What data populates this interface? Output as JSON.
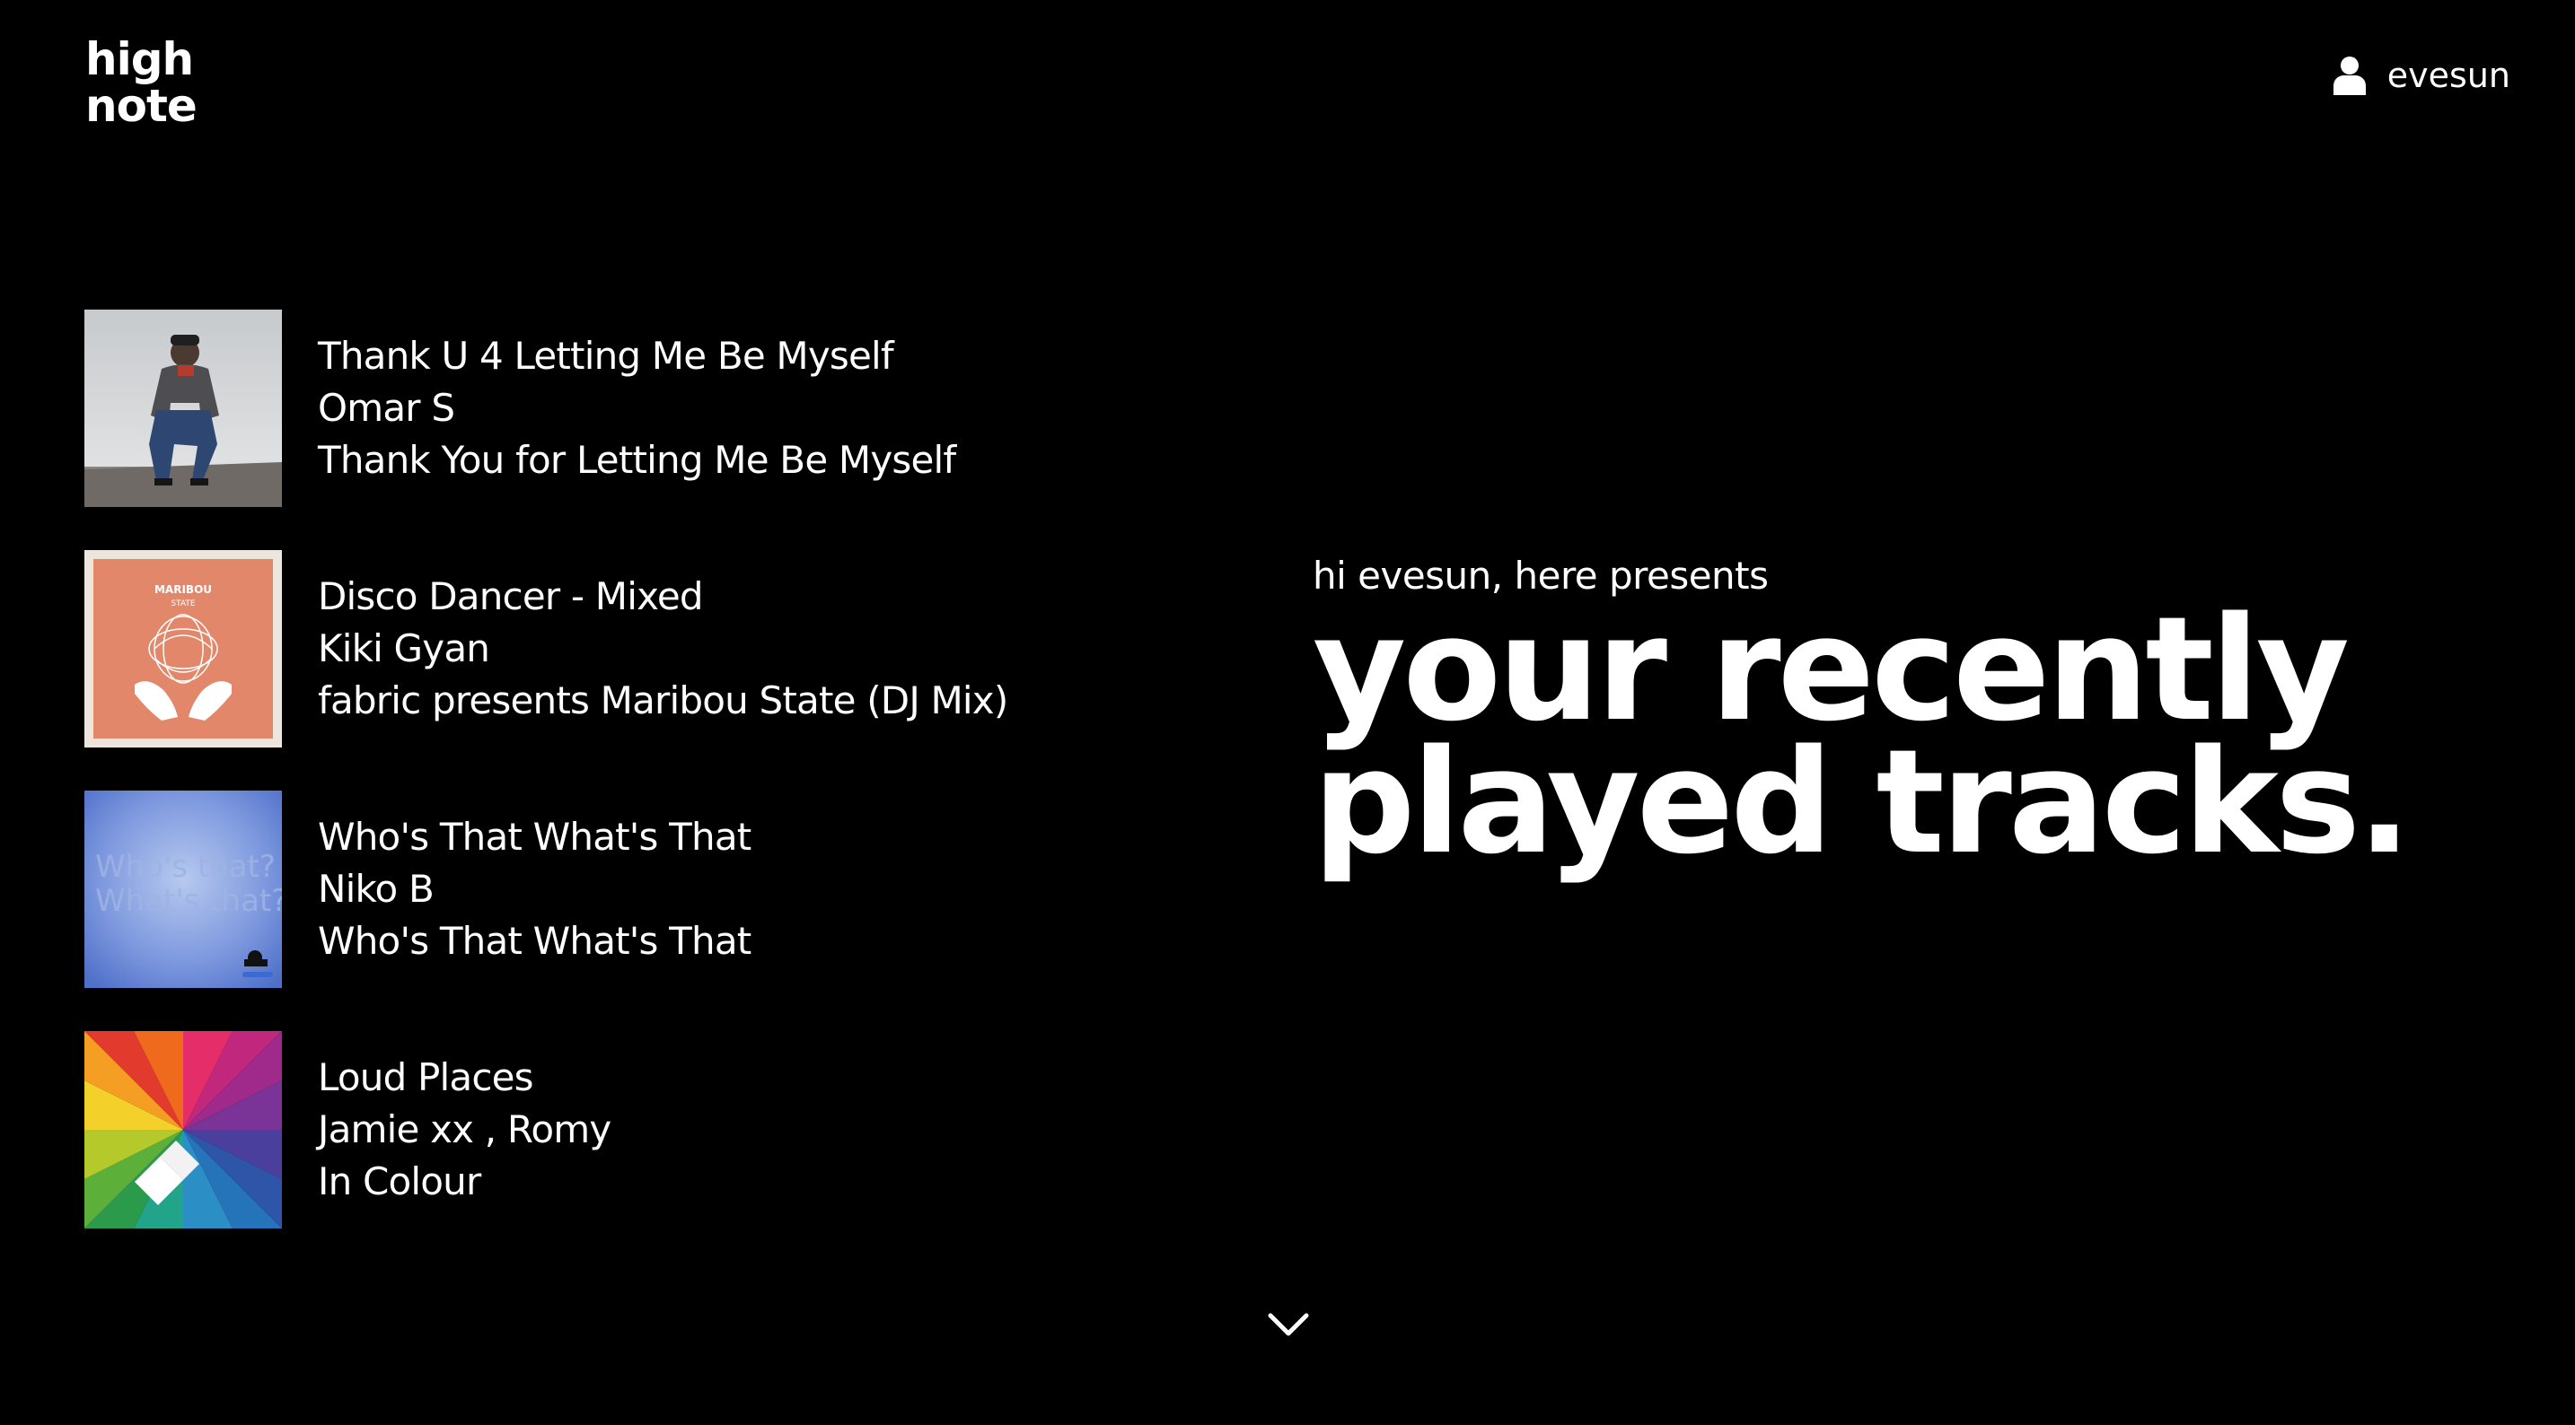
{
  "logo": {
    "line1": "high",
    "line2": "note"
  },
  "user": {
    "icon": "user-icon",
    "name": "evesun"
  },
  "tracks": [
    {
      "title": "Thank U 4 Letting Me Be Myself",
      "artist": "Omar S",
      "album": "Thank You for Letting Me Be Myself",
      "cover": "photo of man crouching"
    },
    {
      "title": "Disco Dancer - Mixed",
      "artist": "Kiki Gyan",
      "album": "fabric presents Maribou State (DJ Mix)",
      "cover": "Maribou State album art",
      "cover_text": {
        "line1": "MARIBOU",
        "line2": "STATE"
      }
    },
    {
      "title": "Who's That What's That",
      "artist": "Niko B",
      "album": "Who's That What's That",
      "cover": "blue blurred art",
      "cover_text": {
        "line1": "Who's that?",
        "line2": "What's that?"
      }
    },
    {
      "title": "Loud Places",
      "artist": "Jamie xx ,  Romy",
      "album": "In Colour",
      "cover": "rainbow spectrum art"
    }
  ],
  "hero": {
    "greeting": "hi evesun, here presents",
    "headline_line1": "your recently",
    "headline_line2": "played tracks."
  },
  "scroll": {
    "icon": "chevron-down-icon"
  },
  "colors": {
    "background": "#000000",
    "text": "#ffffff",
    "cover_maribou": "#e3876b"
  }
}
